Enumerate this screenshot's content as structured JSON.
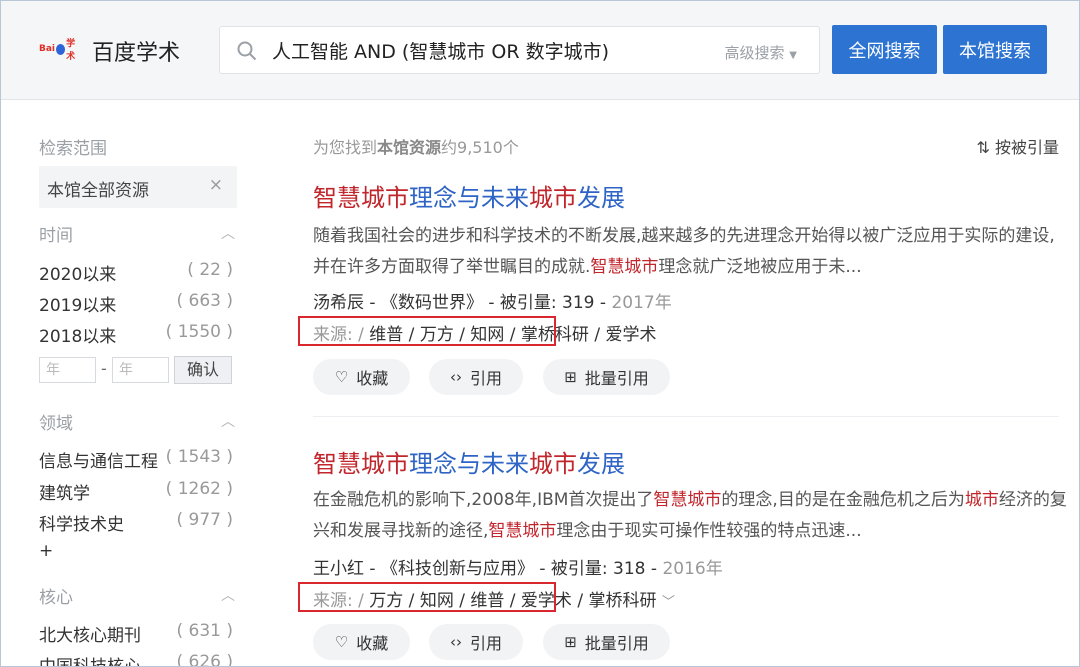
{
  "header": {
    "logo_text": "百度学术",
    "search_value": "人工智能 AND (智慧城市 OR 数字城市)",
    "advanced_label": "高级搜索",
    "btn_web": "全网搜索",
    "btn_library": "本馆搜索"
  },
  "sidebar": {
    "scope_title": "检索范围",
    "scope_value": "本馆全部资源",
    "time_title": "时间",
    "time_items": [
      {
        "label": "2020以来",
        "count": "( 22 )"
      },
      {
        "label": "2019以来",
        "count": "( 663 )"
      },
      {
        "label": "2018以来",
        "count": "( 1550 )"
      }
    ],
    "year_placeholder_from": "年",
    "year_placeholder_to": "年",
    "confirm_label": "确认",
    "field_title": "领域",
    "field_items": [
      {
        "label": "信息与通信工程",
        "count": "( 1543 )"
      },
      {
        "label": "建筑学",
        "count": "( 1262 )"
      },
      {
        "label": "科学技术史",
        "count": "( 977 )"
      }
    ],
    "more_label": "+",
    "core_title": "核心",
    "core_items": [
      {
        "label": "北大核心期刊",
        "count": "( 631 )"
      },
      {
        "label": "中国科技核心",
        "count": "( 626 )"
      }
    ]
  },
  "results": {
    "count_prefix": "为您找到",
    "count_bold": "本馆资源",
    "count_suffix": "约9,510个",
    "sort_label": "按被引量",
    "items": [
      {
        "title_parts": [
          "智慧城市",
          "理念与未来",
          "城市",
          "发展"
        ],
        "abstract_line1": "随着我国社会的进步和科学技术的不断发展,越来越多的先进理念开始得以被广泛应用于实际的建设,",
        "abstract_line2_a": "并在许多方面取得了举世瞩目的成就.",
        "abstract_line2_hl": "智慧城市",
        "abstract_line2_b": "理念就广泛地被应用于未...",
        "author": "汤希辰",
        "journal": "《数码世界》",
        "cited_label": "被引量:",
        "cited": "319",
        "year": "2017年",
        "source_label": "来源:",
        "sources": [
          "维普",
          "万方",
          "知网",
          "掌桥科研",
          "爱学术"
        ],
        "actions": [
          "收藏",
          "引用",
          "批量引用"
        ]
      },
      {
        "title_parts": [
          "智慧城市",
          "理念与未来",
          "城市",
          "发展"
        ],
        "abstract_line1_a": "在金融危机的影响下,2008年,IBM首次提出了",
        "abstract_line1_hl": "智慧城市",
        "abstract_line1_b": "的理念,目的是在金融危机之后为",
        "abstract_line1_hl2": "城市",
        "abstract_line1_c": "经济的复",
        "abstract_line2_a": "兴和发展寻找新的途径,",
        "abstract_line2_hl": "智慧城市",
        "abstract_line2_b": "理念由于现实可操作性较强的特点迅速...",
        "author": "王小红",
        "journal": "《科技创新与应用》",
        "cited_label": "被引量:",
        "cited": "318",
        "year": "2016年",
        "source_label": "来源:",
        "sources": [
          "万方",
          "知网",
          "维普",
          "爱学术",
          "掌桥科研"
        ],
        "actions": [
          "收藏",
          "引用",
          "批量引用"
        ]
      }
    ]
  },
  "colors": {
    "accent": "#2c73d2",
    "highlight": "#c0262c",
    "link": "#2e64c6",
    "box": "#d9272e"
  }
}
